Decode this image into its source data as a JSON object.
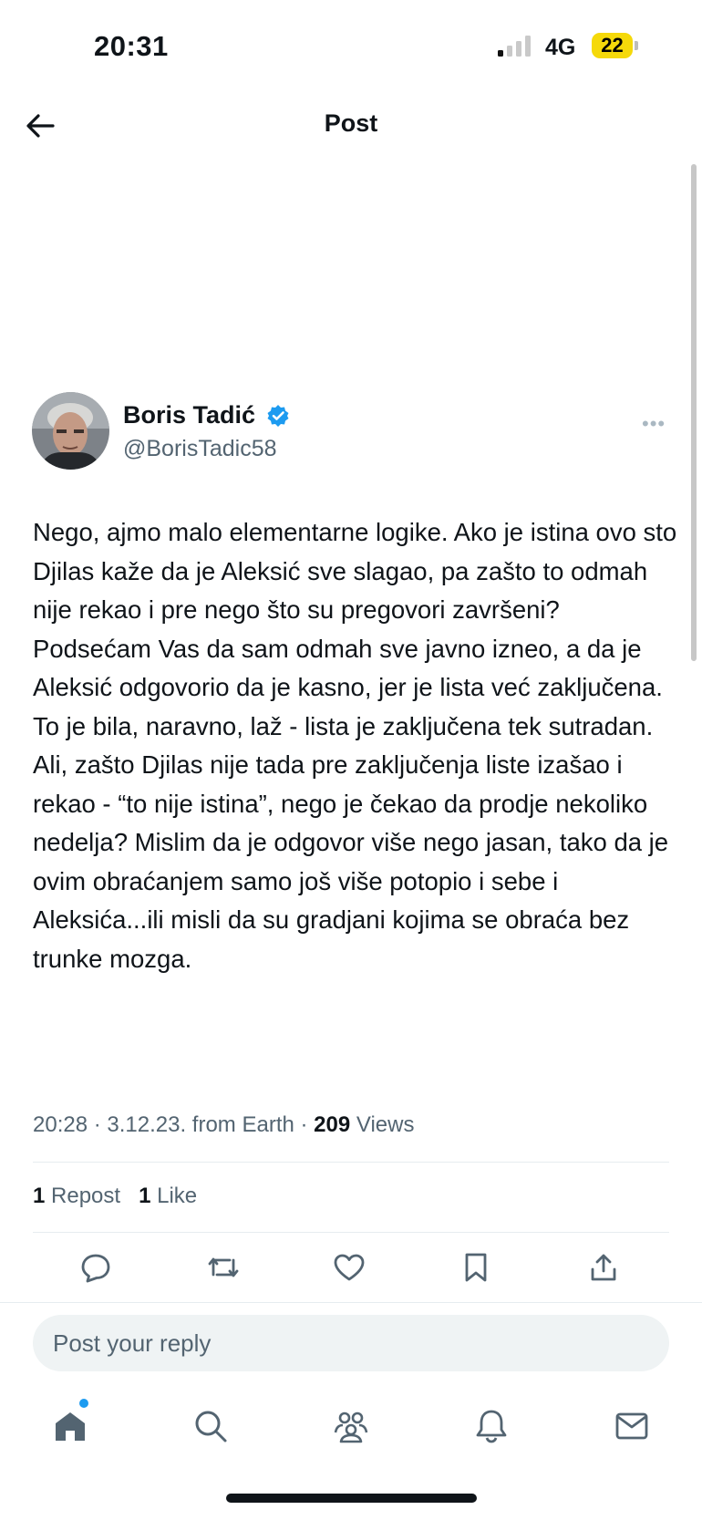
{
  "status_bar": {
    "time": "20:31",
    "network": "4G",
    "battery": "22"
  },
  "header": {
    "title": "Post"
  },
  "author": {
    "name": "Boris Tadić",
    "handle": "@BorisTadic58"
  },
  "post": {
    "text": "Nego, ajmo malo elementarne logike. Ako je istina ovo sto Djilas kaže da je Aleksić sve slagao, pa zašto to odmah nije rekao i pre nego što su pregovori završeni? Podsećam Vas da sam odmah sve javno izneo, a da je Aleksić odgovorio da je kasno, jer je lista već zaključena. To je bila, naravno, laž - lista je zaključena tek sutradan. Ali, zašto Djilas nije tada pre zaključenja liste izašao i rekao - “to nije istina”, nego je čekao da prodje nekoliko nedelja? Mislim da je odgovor više nego jasan, tako da je ovim obraćanjem samo još više potopio i sebe i Aleksića...ili misli da su gradjani kojima se obraća bez trunke mozga.",
    "meta_prefix": "20:28 · 3.12.23. from Earth · ",
    "views_count": "209",
    "views_label": " Views",
    "reposts_count": "1",
    "reposts_label": " Repost",
    "likes_count": "1",
    "likes_label": " Like"
  },
  "reply": {
    "placeholder": "Post your reply"
  },
  "icons": {
    "header": [
      "back-arrow-icon"
    ],
    "actions": [
      "reply-icon",
      "repost-icon",
      "like-icon",
      "bookmark-icon",
      "share-icon"
    ],
    "tab_bar": [
      "home-icon",
      "search-icon",
      "communities-icon",
      "notifications-icon",
      "messages-icon"
    ]
  },
  "colors": {
    "verified": "#1d9bf0",
    "secondary_text": "#536471",
    "battery": "#f5d90a"
  }
}
